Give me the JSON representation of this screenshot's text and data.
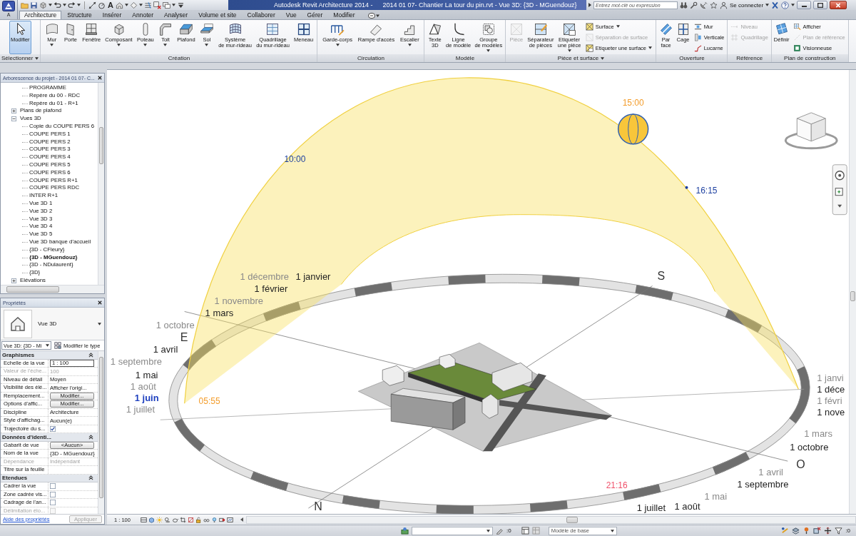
{
  "title_bar": {
    "app_button": {
      "label": "A"
    },
    "quick_access": {
      "text_tool": "A"
    },
    "title": "Autodesk Revit Architecture 2014 -",
    "document": "2014 01 07- Chantier La tour du pin.rvt - Vue 3D: {3D - MGuendouz}",
    "search": {
      "placeholder": "Entrez mot-clé ou expression"
    },
    "sign_in": "Se connecter"
  },
  "ribbon_tabs": [
    {
      "label": "Architecture",
      "selected": true
    },
    {
      "label": "Structure",
      "selected": false
    },
    {
      "label": "Insérer",
      "selected": false
    },
    {
      "label": "Annoter",
      "selected": false
    },
    {
      "label": "Analyser",
      "selected": false
    },
    {
      "label": "Volume et site",
      "selected": false
    },
    {
      "label": "Collaborer",
      "selected": false
    },
    {
      "label": "Vue",
      "selected": false
    },
    {
      "label": "Gérer",
      "selected": false
    },
    {
      "label": "Modifier",
      "selected": false
    }
  ],
  "ribbon_panels": [
    {
      "title": "Sélectionner",
      "menu": true,
      "buttons": [
        {
          "label": "Modifier",
          "kind": "large",
          "dropdown": false,
          "disabled": false,
          "active": true
        }
      ]
    },
    {
      "title": "Création",
      "menu": false,
      "buttons": [
        {
          "label": "Mur",
          "kind": "large",
          "dropdown": true,
          "disabled": false,
          "active": false
        },
        {
          "label": "Porte",
          "kind": "large",
          "dropdown": false,
          "disabled": false,
          "active": false
        },
        {
          "label": "Fenêtre",
          "kind": "large",
          "dropdown": false,
          "disabled": false,
          "active": false
        },
        {
          "label": "Composant",
          "kind": "large",
          "dropdown": true,
          "disabled": false,
          "active": false
        },
        {
          "label": "Poteau",
          "kind": "large",
          "dropdown": true,
          "disabled": false,
          "active": false
        },
        {
          "label": "Toit",
          "kind": "large",
          "dropdown": true,
          "disabled": false,
          "active": false
        },
        {
          "label": "Plafond",
          "kind": "large",
          "dropdown": false,
          "disabled": false,
          "active": false
        },
        {
          "label": "Sol",
          "kind": "large",
          "dropdown": true,
          "disabled": false,
          "active": false
        },
        {
          "label": "Système\nde mur-rideau",
          "kind": "large",
          "dropdown": false,
          "disabled": false,
          "active": false
        },
        {
          "label": "Quadrillage\ndu mur-rideau",
          "kind": "large",
          "dropdown": false,
          "disabled": false,
          "active": false
        },
        {
          "label": "Meneau",
          "kind": "large",
          "dropdown": false,
          "disabled": false,
          "active": false
        }
      ]
    },
    {
      "title": "Circulation",
      "menu": false,
      "buttons": [
        {
          "label": "Garde-corps",
          "kind": "large",
          "dropdown": true,
          "disabled": false,
          "active": false
        },
        {
          "label": "Rampe d'accès",
          "kind": "large",
          "dropdown": false,
          "disabled": false,
          "active": false
        },
        {
          "label": "Escalier",
          "kind": "large",
          "dropdown": true,
          "disabled": false,
          "active": false
        }
      ]
    },
    {
      "title": "Modèle",
      "menu": false,
      "buttons": [
        {
          "label": "Texte\n3D",
          "kind": "large",
          "dropdown": false,
          "disabled": false,
          "active": false
        },
        {
          "label": "Ligne\nde modèle",
          "kind": "large",
          "dropdown": false,
          "disabled": false,
          "active": false
        },
        {
          "label": "Groupe\nde modèles",
          "kind": "large",
          "dropdown": true,
          "disabled": false,
          "active": false
        }
      ]
    },
    {
      "title": "Pièce et surface",
      "menu": true,
      "buttons": [
        {
          "label": "Pièce",
          "kind": "large",
          "dropdown": false,
          "disabled": true,
          "active": false
        },
        {
          "label": "Séparateur\nde pièces",
          "kind": "large",
          "dropdown": false,
          "disabled": false,
          "active": false
        },
        {
          "label": "Etiqueter\nune pièce",
          "kind": "large",
          "dropdown": true,
          "disabled": false,
          "active": false
        },
        {
          "label": "Surface",
          "kind": "small",
          "dropdown": true,
          "disabled": false,
          "active": false
        },
        {
          "label": "Séparation de surface",
          "kind": "small",
          "dropdown": false,
          "disabled": true,
          "active": false
        },
        {
          "label": "Etiqueter une surface",
          "kind": "small",
          "dropdown": true,
          "disabled": false,
          "active": false
        }
      ]
    },
    {
      "title": "Ouverture",
      "menu": false,
      "buttons": [
        {
          "label": "Par\nface",
          "kind": "large",
          "dropdown": false,
          "disabled": false,
          "active": false
        },
        {
          "label": "Cage",
          "kind": "large",
          "dropdown": false,
          "disabled": false,
          "active": false
        },
        {
          "label": "Mur",
          "kind": "small",
          "dropdown": false,
          "disabled": false,
          "active": false
        },
        {
          "label": "Verticale",
          "kind": "small",
          "dropdown": false,
          "disabled": false,
          "active": false
        },
        {
          "label": "Lucarne",
          "kind": "small",
          "dropdown": false,
          "disabled": false,
          "active": false
        }
      ]
    },
    {
      "title": "Référence",
      "menu": false,
      "buttons": [
        {
          "label": "Niveau",
          "kind": "small",
          "dropdown": false,
          "disabled": true,
          "active": false
        },
        {
          "label": "Quadrillage",
          "kind": "small",
          "dropdown": false,
          "disabled": true,
          "active": false
        }
      ]
    },
    {
      "title": "Plan de construction",
      "menu": false,
      "buttons": [
        {
          "label": "Définir",
          "kind": "large",
          "dropdown": false,
          "disabled": false,
          "active": false
        },
        {
          "label": "Afficher",
          "kind": "small",
          "dropdown": false,
          "disabled": false,
          "active": false
        },
        {
          "label": "Plan de référence",
          "kind": "small",
          "dropdown": false,
          "disabled": true,
          "active": false
        },
        {
          "label": "Visionneuse",
          "kind": "small",
          "dropdown": false,
          "disabled": false,
          "active": false
        }
      ]
    }
  ],
  "project_browser": {
    "title": "Arborescence du projet - 2014 01 07- C...",
    "continued": [
      "PROGRAMME",
      "Repère du 00 - RDC",
      "Repère du 01 - R+1"
    ],
    "tree": [
      {
        "label": "Plans de plafond",
        "expanded": false
      },
      {
        "label": "Vues 3D",
        "expanded": true,
        "children": [
          {
            "label": "Copie du COUPE PERS 6",
            "selected": false
          },
          {
            "label": "COUPE PERS 1",
            "selected": false
          },
          {
            "label": "COUPE PERS 2",
            "selected": false
          },
          {
            "label": "COUPE PERS 3",
            "selected": false
          },
          {
            "label": "COUPE PERS 4",
            "selected": false
          },
          {
            "label": "COUPE PERS 5",
            "selected": false
          },
          {
            "label": "COUPE PERS 6",
            "selected": false
          },
          {
            "label": "COUPE PERS R+1",
            "selected": false
          },
          {
            "label": "COUPE PERS RDC",
            "selected": false
          },
          {
            "label": "INTER R+1",
            "selected": false
          },
          {
            "label": "Vue 3D 1",
            "selected": false
          },
          {
            "label": "Vue 3D 2",
            "selected": false
          },
          {
            "label": "Vue 3D 3",
            "selected": false
          },
          {
            "label": "Vue 3D 4",
            "selected": false
          },
          {
            "label": "Vue 3D 5",
            "selected": false
          },
          {
            "label": "Vue 3D banque d'accueil",
            "selected": false
          },
          {
            "label": "{3D - CFleury}",
            "selected": false
          },
          {
            "label": "{3D - MGuendouz}",
            "selected": true
          },
          {
            "label": "{3D - NDulaurent}",
            "selected": false
          },
          {
            "label": "{3D}",
            "selected": false
          }
        ]
      },
      {
        "label": "Elévations",
        "expanded": false
      }
    ]
  },
  "properties": {
    "title": "Propriétés",
    "type": {
      "label": "Vue 3D"
    },
    "instance": "Vue 3D: {3D - Mi",
    "edit_type": "Modifier le type",
    "groups": [
      {
        "label": "Graphismes",
        "expanded": true,
        "rows": [
          {
            "name": "Echelle de la vue",
            "kind": "input",
            "value": "1 : 100",
            "disabled": false
          },
          {
            "name": "Valeur de l'éche...",
            "kind": "text",
            "value": "100",
            "disabled": true
          },
          {
            "name": "Niveau de détail",
            "kind": "text",
            "value": "Moyen",
            "disabled": false
          },
          {
            "name": "Visibilité des élé...",
            "kind": "text",
            "value": "Afficher l'origi...",
            "disabled": false
          },
          {
            "name": "Remplacement...",
            "kind": "button",
            "value": "Modifier...",
            "disabled": false
          },
          {
            "name": "Options d'affic...",
            "kind": "button",
            "value": "Modifier...",
            "disabled": false
          },
          {
            "name": "Discipline",
            "kind": "text",
            "value": "Architecture",
            "disabled": false
          },
          {
            "name": "Style d'affichag...",
            "kind": "text",
            "value": "Aucun(e)",
            "disabled": false
          },
          {
            "name": "Trajectoire du s...",
            "kind": "checkbox",
            "checked": true,
            "disabled": false
          }
        ]
      },
      {
        "label": "Données d'identi...",
        "expanded": true,
        "rows": [
          {
            "name": "Gabarit de vue",
            "kind": "button",
            "value": "<Aucun>",
            "disabled": false
          },
          {
            "name": "Nom de la vue",
            "kind": "text",
            "value": "{3D - MGuendouz}",
            "disabled": false
          },
          {
            "name": "Dépendance",
            "kind": "text",
            "value": "Indépendant",
            "disabled": true
          },
          {
            "name": "Titre sur la feuille",
            "kind": "text",
            "disabled": false
          }
        ]
      },
      {
        "label": "Etendues",
        "expanded": true,
        "rows": [
          {
            "name": "Cadrer la vue",
            "kind": "checkbox",
            "checked": false,
            "disabled": false
          },
          {
            "name": "Zone cadrée vis...",
            "kind": "checkbox",
            "checked": false,
            "disabled": false
          },
          {
            "name": "Cadrage de l'an...",
            "kind": "checkbox",
            "checked": false,
            "disabled": false
          },
          {
            "name": "Délimitation élo...",
            "kind": "checkbox",
            "checked": false,
            "disabled": true
          }
        ]
      }
    ],
    "help_link": "Aide des propriétés",
    "apply": {
      "label": "Appliquer",
      "disabled": true
    }
  },
  "view": {
    "sun_times": [
      {
        "label": "15:00",
        "color": "#f39c2a"
      },
      {
        "label": "10:00",
        "color": "#1c3fa0"
      },
      {
        "label": "16:15",
        "color": "#1c3fa0"
      },
      {
        "label": "05:55",
        "color": "#f39c2a"
      },
      {
        "label": "21:16",
        "color": "#f0506a"
      }
    ],
    "compass": [
      {
        "label": "S"
      },
      {
        "label": "E"
      },
      {
        "label": "O"
      },
      {
        "label": "N"
      }
    ],
    "month_labels": [
      {
        "label": "1 décembre",
        "color": "#8a8a8a",
        "current": false
      },
      {
        "label": "1 janvier",
        "color": "#222222",
        "current": false
      },
      {
        "label": "1 février",
        "color": "#222222",
        "current": false
      },
      {
        "label": "1 novembre",
        "color": "#8a8a8a",
        "current": false
      },
      {
        "label": "1 mars",
        "color": "#222222",
        "current": false
      },
      {
        "label": "1 octobre",
        "color": "#8a8a8a",
        "current": false
      },
      {
        "label": "1 avril",
        "color": "#222222",
        "current": false
      },
      {
        "label": "1 septembre",
        "color": "#8a8a8a",
        "current": false
      },
      {
        "label": "1 mai",
        "color": "#222222",
        "current": false
      },
      {
        "label": "1 août",
        "color": "#8a8a8a",
        "current": false
      },
      {
        "label": "1 juin",
        "color": "#1d3fbf",
        "current": true
      },
      {
        "label": "1 juillet",
        "color": "#8a8a8a",
        "current": false
      },
      {
        "label": "1 janvi",
        "color": "#8a8a8a",
        "current": false
      },
      {
        "label": "1 déce",
        "color": "#222222",
        "current": false
      },
      {
        "label": "1 févri",
        "color": "#8a8a8a",
        "current": false
      },
      {
        "label": "1 nove",
        "color": "#222222",
        "current": false
      },
      {
        "label": "1 mars",
        "color": "#8a8a8a",
        "current": false
      },
      {
        "label": "1 octobre",
        "color": "#222222",
        "current": false
      },
      {
        "label": "1 avril",
        "color": "#8a8a8a",
        "current": false
      },
      {
        "label": "1 septembre",
        "color": "#222222",
        "current": false
      },
      {
        "label": "1 mai",
        "color": "#8a8a8a",
        "current": false
      },
      {
        "label": "1 août",
        "color": "#222222",
        "current": false
      },
      {
        "label": "1 juillet",
        "color": "#222222",
        "current": false
      }
    ]
  },
  "view_control_bar": {
    "scale": "1 : 100"
  },
  "status_bar": {
    "editable_count": ":0",
    "design_option": "Modèle de base",
    "filter_count": ":0"
  }
}
